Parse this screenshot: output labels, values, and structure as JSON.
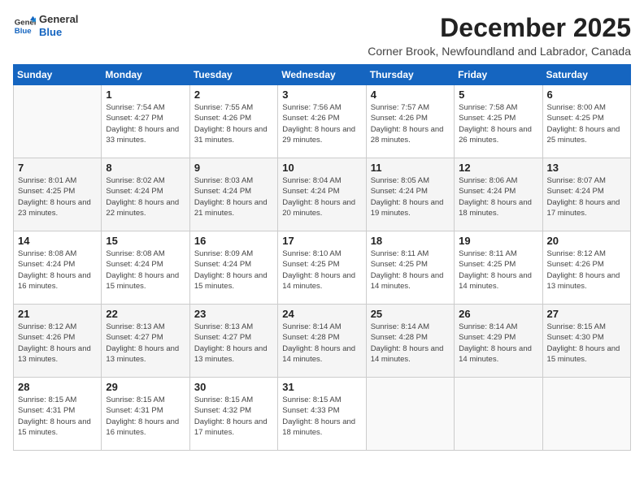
{
  "logo": {
    "line1": "General",
    "line2": "Blue"
  },
  "title": "December 2025",
  "subtitle": "Corner Brook, Newfoundland and Labrador, Canada",
  "days_of_week": [
    "Sunday",
    "Monday",
    "Tuesday",
    "Wednesday",
    "Thursday",
    "Friday",
    "Saturday"
  ],
  "weeks": [
    [
      {
        "day": "",
        "info": ""
      },
      {
        "day": "1",
        "info": "Sunrise: 7:54 AM\nSunset: 4:27 PM\nDaylight: 8 hours\nand 33 minutes."
      },
      {
        "day": "2",
        "info": "Sunrise: 7:55 AM\nSunset: 4:26 PM\nDaylight: 8 hours\nand 31 minutes."
      },
      {
        "day": "3",
        "info": "Sunrise: 7:56 AM\nSunset: 4:26 PM\nDaylight: 8 hours\nand 29 minutes."
      },
      {
        "day": "4",
        "info": "Sunrise: 7:57 AM\nSunset: 4:26 PM\nDaylight: 8 hours\nand 28 minutes."
      },
      {
        "day": "5",
        "info": "Sunrise: 7:58 AM\nSunset: 4:25 PM\nDaylight: 8 hours\nand 26 minutes."
      },
      {
        "day": "6",
        "info": "Sunrise: 8:00 AM\nSunset: 4:25 PM\nDaylight: 8 hours\nand 25 minutes."
      }
    ],
    [
      {
        "day": "7",
        "info": "Sunrise: 8:01 AM\nSunset: 4:25 PM\nDaylight: 8 hours\nand 23 minutes."
      },
      {
        "day": "8",
        "info": "Sunrise: 8:02 AM\nSunset: 4:24 PM\nDaylight: 8 hours\nand 22 minutes."
      },
      {
        "day": "9",
        "info": "Sunrise: 8:03 AM\nSunset: 4:24 PM\nDaylight: 8 hours\nand 21 minutes."
      },
      {
        "day": "10",
        "info": "Sunrise: 8:04 AM\nSunset: 4:24 PM\nDaylight: 8 hours\nand 20 minutes."
      },
      {
        "day": "11",
        "info": "Sunrise: 8:05 AM\nSunset: 4:24 PM\nDaylight: 8 hours\nand 19 minutes."
      },
      {
        "day": "12",
        "info": "Sunrise: 8:06 AM\nSunset: 4:24 PM\nDaylight: 8 hours\nand 18 minutes."
      },
      {
        "day": "13",
        "info": "Sunrise: 8:07 AM\nSunset: 4:24 PM\nDaylight: 8 hours\nand 17 minutes."
      }
    ],
    [
      {
        "day": "14",
        "info": "Sunrise: 8:08 AM\nSunset: 4:24 PM\nDaylight: 8 hours\nand 16 minutes."
      },
      {
        "day": "15",
        "info": "Sunrise: 8:08 AM\nSunset: 4:24 PM\nDaylight: 8 hours\nand 15 minutes."
      },
      {
        "day": "16",
        "info": "Sunrise: 8:09 AM\nSunset: 4:24 PM\nDaylight: 8 hours\nand 15 minutes."
      },
      {
        "day": "17",
        "info": "Sunrise: 8:10 AM\nSunset: 4:25 PM\nDaylight: 8 hours\nand 14 minutes."
      },
      {
        "day": "18",
        "info": "Sunrise: 8:11 AM\nSunset: 4:25 PM\nDaylight: 8 hours\nand 14 minutes."
      },
      {
        "day": "19",
        "info": "Sunrise: 8:11 AM\nSunset: 4:25 PM\nDaylight: 8 hours\nand 14 minutes."
      },
      {
        "day": "20",
        "info": "Sunrise: 8:12 AM\nSunset: 4:26 PM\nDaylight: 8 hours\nand 13 minutes."
      }
    ],
    [
      {
        "day": "21",
        "info": "Sunrise: 8:12 AM\nSunset: 4:26 PM\nDaylight: 8 hours\nand 13 minutes."
      },
      {
        "day": "22",
        "info": "Sunrise: 8:13 AM\nSunset: 4:27 PM\nDaylight: 8 hours\nand 13 minutes."
      },
      {
        "day": "23",
        "info": "Sunrise: 8:13 AM\nSunset: 4:27 PM\nDaylight: 8 hours\nand 13 minutes."
      },
      {
        "day": "24",
        "info": "Sunrise: 8:14 AM\nSunset: 4:28 PM\nDaylight: 8 hours\nand 14 minutes."
      },
      {
        "day": "25",
        "info": "Sunrise: 8:14 AM\nSunset: 4:28 PM\nDaylight: 8 hours\nand 14 minutes."
      },
      {
        "day": "26",
        "info": "Sunrise: 8:14 AM\nSunset: 4:29 PM\nDaylight: 8 hours\nand 14 minutes."
      },
      {
        "day": "27",
        "info": "Sunrise: 8:15 AM\nSunset: 4:30 PM\nDaylight: 8 hours\nand 15 minutes."
      }
    ],
    [
      {
        "day": "28",
        "info": "Sunrise: 8:15 AM\nSunset: 4:31 PM\nDaylight: 8 hours\nand 15 minutes."
      },
      {
        "day": "29",
        "info": "Sunrise: 8:15 AM\nSunset: 4:31 PM\nDaylight: 8 hours\nand 16 minutes."
      },
      {
        "day": "30",
        "info": "Sunrise: 8:15 AM\nSunset: 4:32 PM\nDaylight: 8 hours\nand 17 minutes."
      },
      {
        "day": "31",
        "info": "Sunrise: 8:15 AM\nSunset: 4:33 PM\nDaylight: 8 hours\nand 18 minutes."
      },
      {
        "day": "",
        "info": ""
      },
      {
        "day": "",
        "info": ""
      },
      {
        "day": "",
        "info": ""
      }
    ]
  ]
}
